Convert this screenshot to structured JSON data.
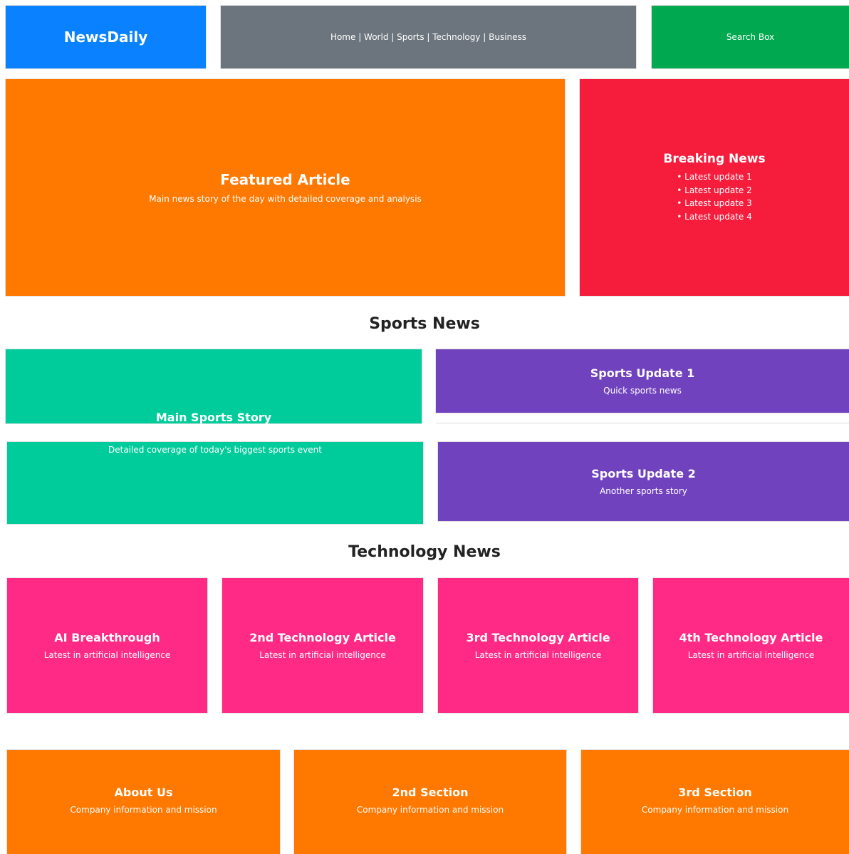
{
  "header": {
    "logo": "NewsDaily",
    "nav": "Home | World | Sports | Technology | Business",
    "search": "Search Box"
  },
  "featured": {
    "title": "Featured Article",
    "subtitle": "Main news story of the day with detailed coverage and analysis"
  },
  "breaking": {
    "title": "Breaking News",
    "items": [
      "• Latest update 1",
      "• Latest update 2",
      "• Latest update 3",
      "• Latest update 4"
    ]
  },
  "sports": {
    "heading": "Sports News",
    "main_title": "Main Sports Story",
    "main_subtitle": "Detailed coverage of today's biggest sports event",
    "updates": [
      {
        "title": "Sports Update 1",
        "subtitle": "Quick sports news"
      },
      {
        "title": "Sports Update 2",
        "subtitle": "Another sports story"
      }
    ]
  },
  "technology": {
    "heading": "Technology News",
    "articles": [
      {
        "title": "AI Breakthrough",
        "subtitle": "Latest in artificial intelligence"
      },
      {
        "title": "2nd Technology Article",
        "subtitle": "Latest in artificial intelligence"
      },
      {
        "title": "3rd Technology Article",
        "subtitle": "Latest in artificial intelligence"
      },
      {
        "title": "4th Technology Article",
        "subtitle": "Latest in artificial intelligence"
      }
    ]
  },
  "footer": {
    "sections": [
      {
        "title": "About Us",
        "subtitle": "Company information and mission"
      },
      {
        "title": "2nd Section",
        "subtitle": "Company information and mission"
      },
      {
        "title": "3rd Section",
        "subtitle": "Company information and mission"
      }
    ]
  },
  "colors": {
    "logo_bg": "#0a82ff",
    "nav_bg": "#6c757d",
    "search_bg": "#00a84f",
    "featured_bg": "#ff7800",
    "breaking_bg": "#f51c3c",
    "teal": "#00cc9b",
    "purple": "#7142be",
    "pink": "#ff2a85",
    "orange": "#ff7800"
  }
}
